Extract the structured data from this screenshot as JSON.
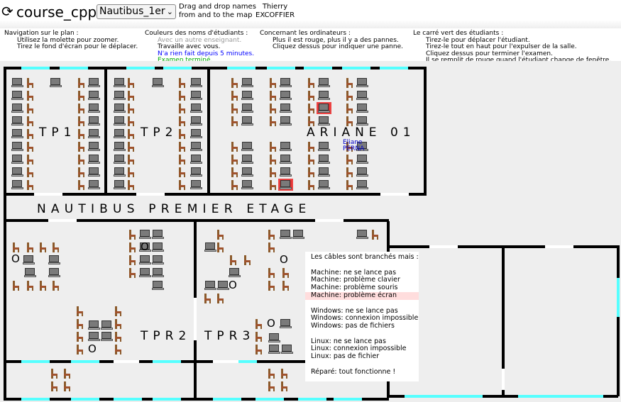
{
  "header": {
    "reload_icon": "reload-icon",
    "course": "course_cpp",
    "room": "Nautibus_1er",
    "drag_line1": "Drag and drop names",
    "drag_line2": "from and to the map",
    "teacher_first": "Thierry",
    "teacher_last": "EXCOFFIER"
  },
  "help": {
    "nav": {
      "title": "Navigation sur le plan :",
      "l1": "Utilisez la molette pour zoomer.",
      "l2": "Tirez le fond d'écran pour le déplacer."
    },
    "colors": {
      "title": "Couleurs des noms d'étudiants :",
      "l1": "Avec un autre enseignant.",
      "l2": "Travaille avec vous.",
      "l3": "N'a rien fait depuis 5 minutes.",
      "l4": "Examen terminé.",
      "c1": "#999999",
      "c2": "#000000",
      "c3": "#0000ff",
      "c4": "#00aa00"
    },
    "computers": {
      "title": "Concernant les ordinateurs :",
      "l1": "Plus il est rouge, plus il y a des pannes.",
      "l2": "Cliquez dessus pour indiquer une panne."
    },
    "square": {
      "title": "Le carré vert des étudiants :",
      "l1": "Tirez-le pour déplacer l'étudiant.",
      "l2": "Tirez-le tout en haut pour l'expulser de la salle.",
      "l3": "Cliquez dessus pour terminer l'examen.",
      "l4": "Il se remplit de rouge quand l'étudiant change de fenêtre."
    }
  },
  "rooms": {
    "tp1": "TP1",
    "tp2": "TP2",
    "ariane": "ARIANE 01",
    "corridor": "NAUTIBUS PREMIER ETAGE",
    "tpr2": "TPR2",
    "tpr3": "TPR3"
  },
  "student": {
    "first": "Eliane",
    "last": "PERNA"
  },
  "ring_glyph": "O",
  "menu": {
    "header": "Les câbles sont branchés mais :",
    "items": [
      "Machine: ne se lance pas",
      "Machine: problème clavier",
      "Machine: problème souris",
      "Machine: problème écran",
      "Windows: ne se lance pas",
      "Windows: connexion impossible",
      "Windows: pas de fichiers",
      "Linux: ne se lance pas",
      "Linux: connexion impossible",
      "Linux: pas de fichier",
      "Réparé: tout fonctionne !"
    ],
    "highlighted": "Machine: problème écran"
  },
  "colors": {
    "window": "#55ffff",
    "broken": "#dd3333",
    "menu_highlight": "#ffdddd"
  }
}
